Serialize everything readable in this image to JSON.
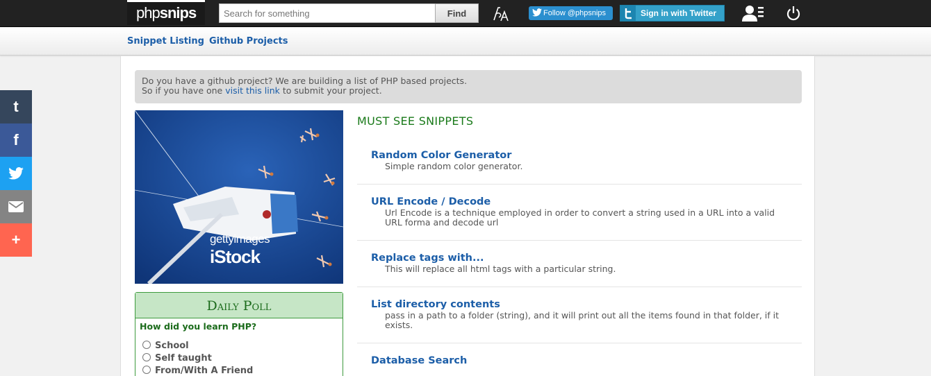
{
  "header": {
    "logo_light": "php",
    "logo_bold": "snips",
    "search_placeholder": "Search for something",
    "find_label": "Find",
    "follow_label": "Follow @phpsnips",
    "signin_label": "Sign in with Twitter"
  },
  "subnav": {
    "items": [
      {
        "label": "Snippet Listing"
      },
      {
        "label": "Github Projects"
      }
    ]
  },
  "notice": {
    "line1": "Do you have a github project? We are building a list of PHP based projects.",
    "line2_before": "So if you have one ",
    "line2_link": "visit this link",
    "line2_after": " to submit your project."
  },
  "ad": {
    "brand_top": "gettyimages",
    "brand_bottom": "iStock"
  },
  "poll": {
    "title": "Daily Poll",
    "question": "How did you learn PHP?",
    "options": [
      "School",
      "Self taught",
      "From/With A Friend"
    ]
  },
  "snippets": {
    "heading": "MUST SEE SNIPPETS",
    "items": [
      {
        "title": "Random Color Generator",
        "desc": "Simple random color generator."
      },
      {
        "title": "URL Encode / Decode",
        "desc": "Url Encode is a technique employed in order to convert a string used in a URL into a valid URL forma and decode url"
      },
      {
        "title": "Replace tags with...",
        "desc": "This will replace all html tags with a particular string."
      },
      {
        "title": "List directory contents",
        "desc": "pass in a path to a folder (string), and it will print out all the items found in that folder, if it exists."
      },
      {
        "title": "Database Search",
        "desc": ""
      }
    ]
  },
  "share": [
    {
      "icon": "tumblr-icon",
      "glyph": "t",
      "color": "#35465c"
    },
    {
      "icon": "facebook-icon",
      "glyph": "f",
      "color": "#3b5998"
    },
    {
      "icon": "twitter-icon",
      "glyph": "",
      "color": "#1da1f2"
    },
    {
      "icon": "email-icon",
      "glyph": "",
      "color": "#848484"
    },
    {
      "icon": "plus-icon",
      "glyph": "+",
      "color": "#ff6550"
    }
  ]
}
